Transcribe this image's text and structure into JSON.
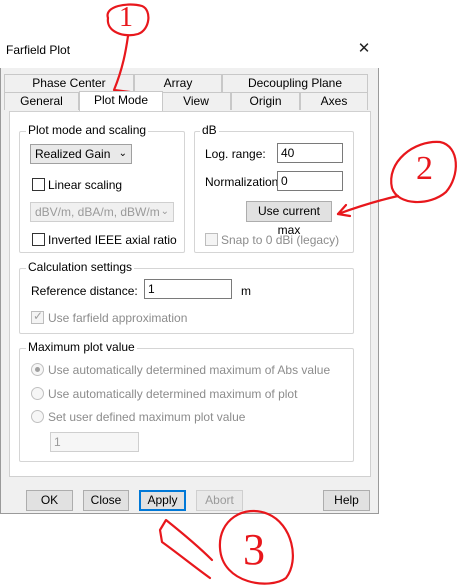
{
  "window": {
    "title": "Farfield Plot"
  },
  "tabs_row1": [
    "Phase Center",
    "Array",
    "Decoupling Plane"
  ],
  "tabs_row2": [
    "General",
    "Plot Mode",
    "View",
    "Origin",
    "Axes"
  ],
  "plot_mode": {
    "group_label": "Plot mode and scaling",
    "mode_value": "Realized Gain",
    "linear_scaling_label": "Linear scaling",
    "unit_value": "dBV/m, dBA/m, dBW/m",
    "inverted_ieee_label": "Inverted IEEE axial ratio"
  },
  "db": {
    "group_label": "dB",
    "log_range_label": "Log. range:",
    "log_range_value": "40",
    "normalization_label": "Normalization:",
    "normalization_value": "0",
    "use_current_max_label": "Use current max",
    "snap_label": "Snap to 0 dBi (legacy)"
  },
  "calc": {
    "group_label": "Calculation settings",
    "ref_distance_label": "Reference distance:",
    "ref_distance_value": "1",
    "ref_distance_unit": "m",
    "use_farfield_label": "Use farfield approximation"
  },
  "max_plot": {
    "group_label": "Maximum plot value",
    "opt1": "Use automatically determined maximum of Abs value",
    "opt2": "Use automatically determined maximum of plot",
    "opt3": "Set user defined maximum plot value",
    "user_value": "1"
  },
  "buttons": {
    "ok": "OK",
    "close": "Close",
    "apply": "Apply",
    "abort": "Abort",
    "help": "Help"
  },
  "annotations": {
    "one": "1",
    "two": "2",
    "three": "3",
    "color": "#e8171c"
  }
}
